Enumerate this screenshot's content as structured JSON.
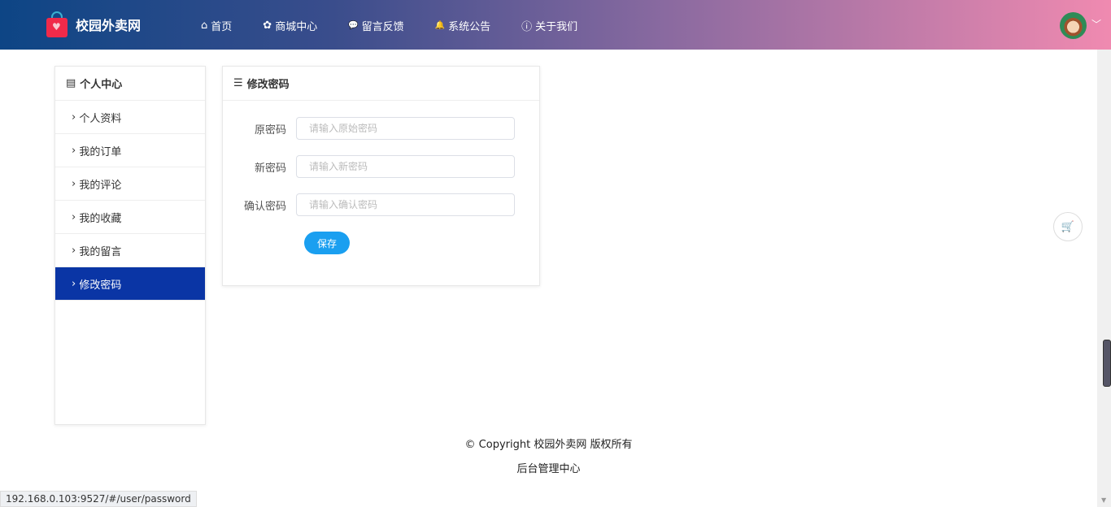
{
  "header": {
    "logo_text": "校园外卖网",
    "nav": [
      {
        "icon": "home-icon",
        "glyph": "⌂",
        "label": "首页"
      },
      {
        "icon": "paw-icon",
        "glyph": "✿",
        "label": "商城中心"
      },
      {
        "icon": "comment-icon",
        "glyph": "💬",
        "label": "留言反馈"
      },
      {
        "icon": "bell-icon",
        "glyph": "🔔",
        "label": "系统公告"
      },
      {
        "icon": "info-icon",
        "glyph": "ⓘ",
        "label": "关于我们"
      }
    ]
  },
  "sidebar": {
    "title": "个人中心",
    "items": [
      {
        "label": "个人资料"
      },
      {
        "label": "我的订单"
      },
      {
        "label": "我的评论"
      },
      {
        "label": "我的收藏"
      },
      {
        "label": "我的留言"
      },
      {
        "label": "修改密码",
        "active": true
      }
    ]
  },
  "form": {
    "title": "修改密码",
    "fields": [
      {
        "label": "原密码",
        "placeholder": "请输入原始密码"
      },
      {
        "label": "新密码",
        "placeholder": "请输入新密码"
      },
      {
        "label": "确认密码",
        "placeholder": "请输入确认密码"
      }
    ],
    "save_label": "保存"
  },
  "footer": {
    "copyright": "© Copyright 校园外卖网 版权所有",
    "admin_link": "后台管理中心"
  },
  "status_url": "192.168.0.103:9527/#/user/password"
}
